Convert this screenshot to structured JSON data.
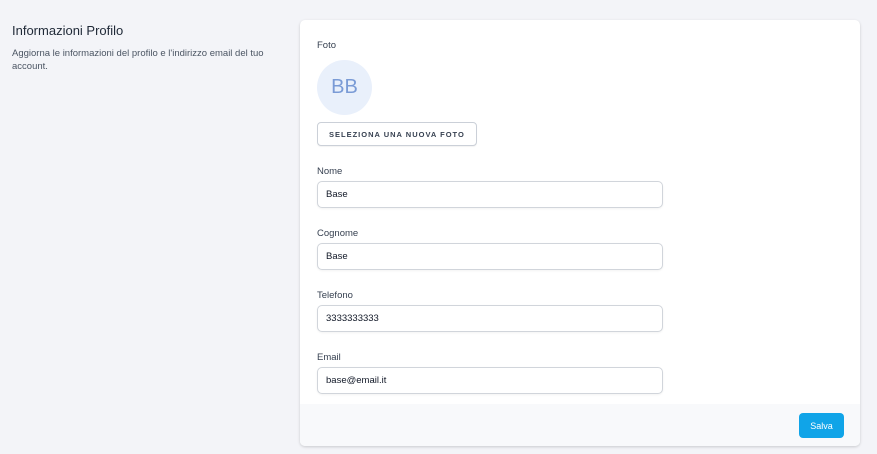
{
  "section": {
    "title": "Informazioni Profilo",
    "description": "Aggiorna le informazioni del profilo e l'indirizzo email del tuo account."
  },
  "photo": {
    "label": "Foto",
    "initials": "BB",
    "select_button_label": "Seleziona una nuova foto"
  },
  "fields": {
    "first_name": {
      "label": "Nome",
      "value": "Base"
    },
    "last_name": {
      "label": "Cognome",
      "value": "Base"
    },
    "phone": {
      "label": "Telefono",
      "value": "3333333333"
    },
    "email": {
      "label": "Email",
      "value": "base@email.it"
    }
  },
  "footer": {
    "save_label": "Salva"
  },
  "colors": {
    "page_background": "#f3f4f8",
    "avatar_background": "#e9f0fb",
    "avatar_text": "#7a9bd6",
    "save_button": "#10a4e8"
  }
}
